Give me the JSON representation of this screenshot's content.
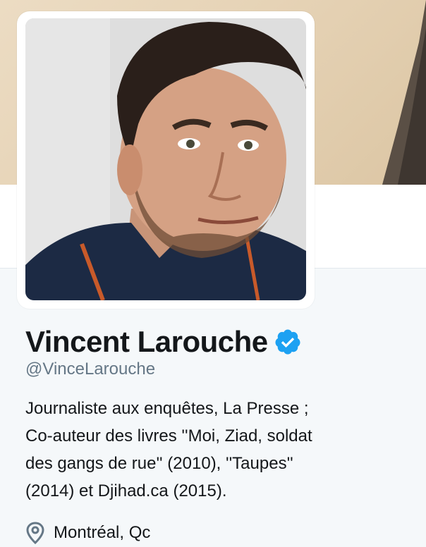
{
  "profile": {
    "name": "Vincent Larouche",
    "handle": "@VinceLarouche",
    "verified": true,
    "bio_lines": [
      "Journaliste aux enquêtes, La Presse ;",
      "Co-auteur des livres ''Moi, Ziad, soldat",
      "des gangs de rue'' (2010), ''Taupes''",
      "(2014) et Djihad.ca (2015)."
    ],
    "location": "Montréal, Qc"
  },
  "icons": {
    "verified": "verified-badge-icon",
    "location": "location-pin-icon"
  },
  "colors": {
    "verified_blue": "#1da1f2",
    "handle_gray": "#657786",
    "text_dark": "#14171a",
    "page_bg": "#f5f8fa"
  }
}
